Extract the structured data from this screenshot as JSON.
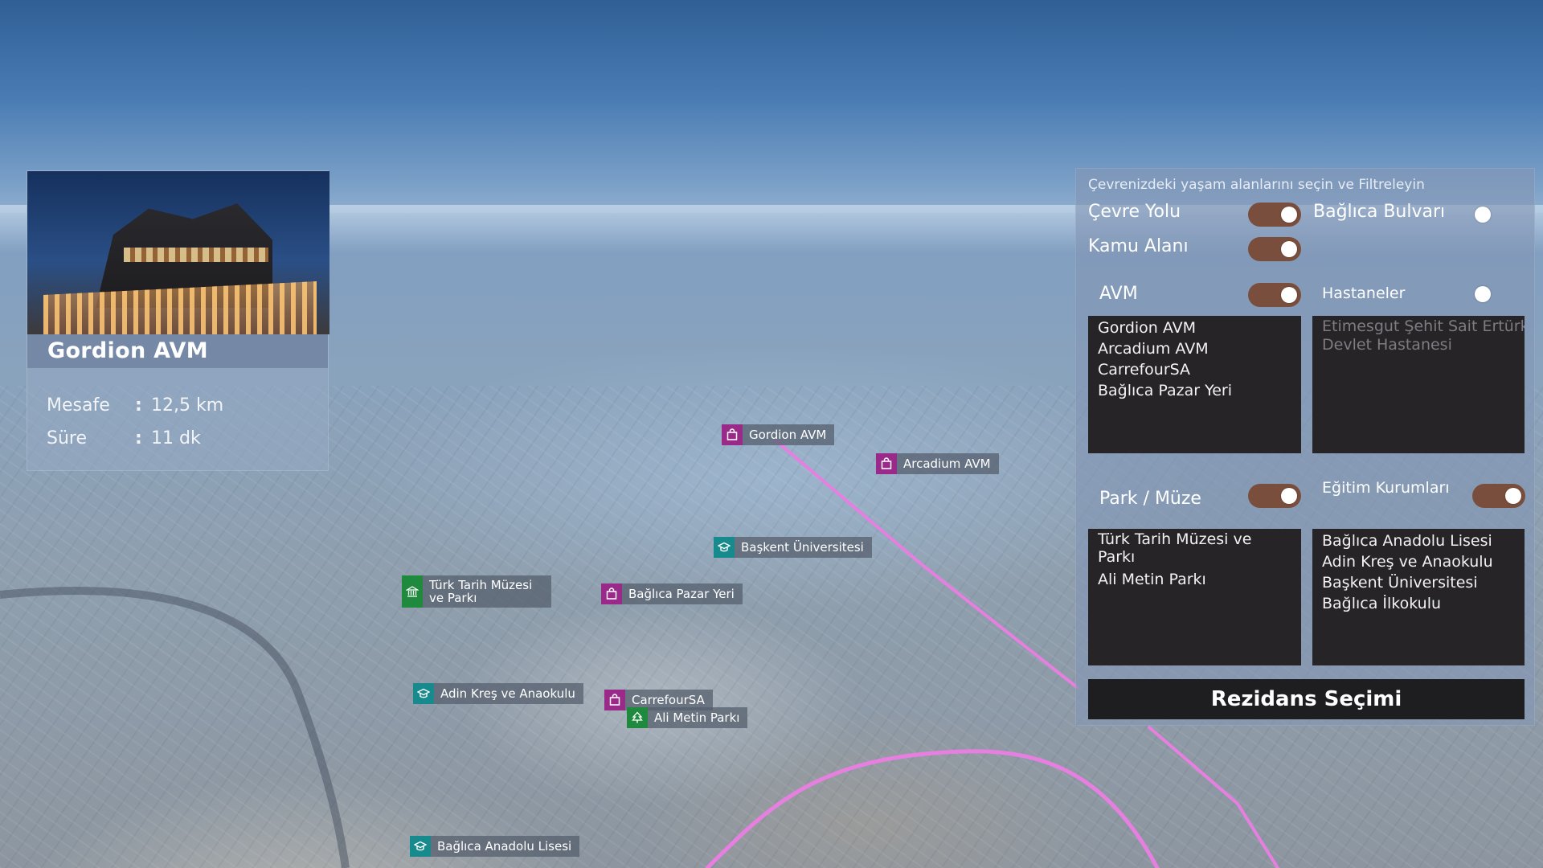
{
  "info_card": {
    "title": "Gordion AVM",
    "distance_label": "Mesafe",
    "distance_value": "12,5 km",
    "duration_label": "Süre",
    "duration_value": "11 dk",
    "separator": ":"
  },
  "markers": [
    {
      "label": "Gordion AVM",
      "icon": "shopping-bag-icon",
      "category": "avm"
    },
    {
      "label": "Arcadium AVM",
      "icon": "shopping-bag-icon",
      "category": "avm"
    },
    {
      "label": "Başkent Üniversitesi",
      "icon": "graduation-cap-icon",
      "category": "edu"
    },
    {
      "label": "Türk Tarih Müzesi ve Parkı",
      "icon": "museum-icon",
      "category": "park"
    },
    {
      "label": "Bağlıca Pazar Yeri",
      "icon": "shopping-bag-icon",
      "category": "avm"
    },
    {
      "label": "Adin Kreş ve Anaokulu",
      "icon": "graduation-cap-icon",
      "category": "edu"
    },
    {
      "label": "CarrefourSA",
      "icon": "shopping-bag-icon",
      "category": "avm"
    },
    {
      "label": "Ali Metin Parkı",
      "icon": "tree-icon",
      "category": "park"
    },
    {
      "label": "Bağlıca Anadolu Lisesi",
      "icon": "graduation-cap-icon",
      "category": "edu"
    }
  ],
  "panel": {
    "title": "Çevrenizdeki yaşam alanlarını seçin ve Filtreleyin",
    "toggles": {
      "cevre_yolu": {
        "label": "Çevre Yolu",
        "on": true
      },
      "baglica_bulvari": {
        "label": "Bağlıca Bulvarı",
        "on": false
      },
      "kamu_alani": {
        "label": "Kamu Alanı",
        "on": true
      },
      "avm": {
        "label": "AVM",
        "on": true
      },
      "hastaneler": {
        "label": "Hastaneler",
        "on": false
      },
      "park_muze": {
        "label": "Park / Müze",
        "on": true
      },
      "egitim": {
        "label": "Eğitim Kurumları",
        "on": true
      }
    },
    "lists": {
      "avm": [
        "Gordion AVM",
        "Arcadium AVM",
        "CarrefourSA",
        "Bağlıca Pazar Yeri"
      ],
      "hastaneler": [
        "Etimesgut Şehit Sait Ertürk",
        "Devlet Hastanesi"
      ],
      "park_muze": [
        "Türk Tarih Müzesi ve Parkı",
        "Ali Metin Parkı"
      ],
      "egitim": [
        "Bağlıca Anadolu Lisesi",
        "Adin Kreş ve Anaokulu",
        "Başkent Üniversitesi",
        "Bağlıca İlkokulu"
      ]
    },
    "action_button": "Rezidans Seçimi"
  },
  "colors": {
    "route_line": "#e77fe0",
    "toggle_on": "#7a4e3c",
    "avm_icon_bg": "#9a2a8a",
    "edu_icon_bg": "#178a8e",
    "park_icon_bg": "#1f8a3e",
    "list_bg": "#262427"
  }
}
